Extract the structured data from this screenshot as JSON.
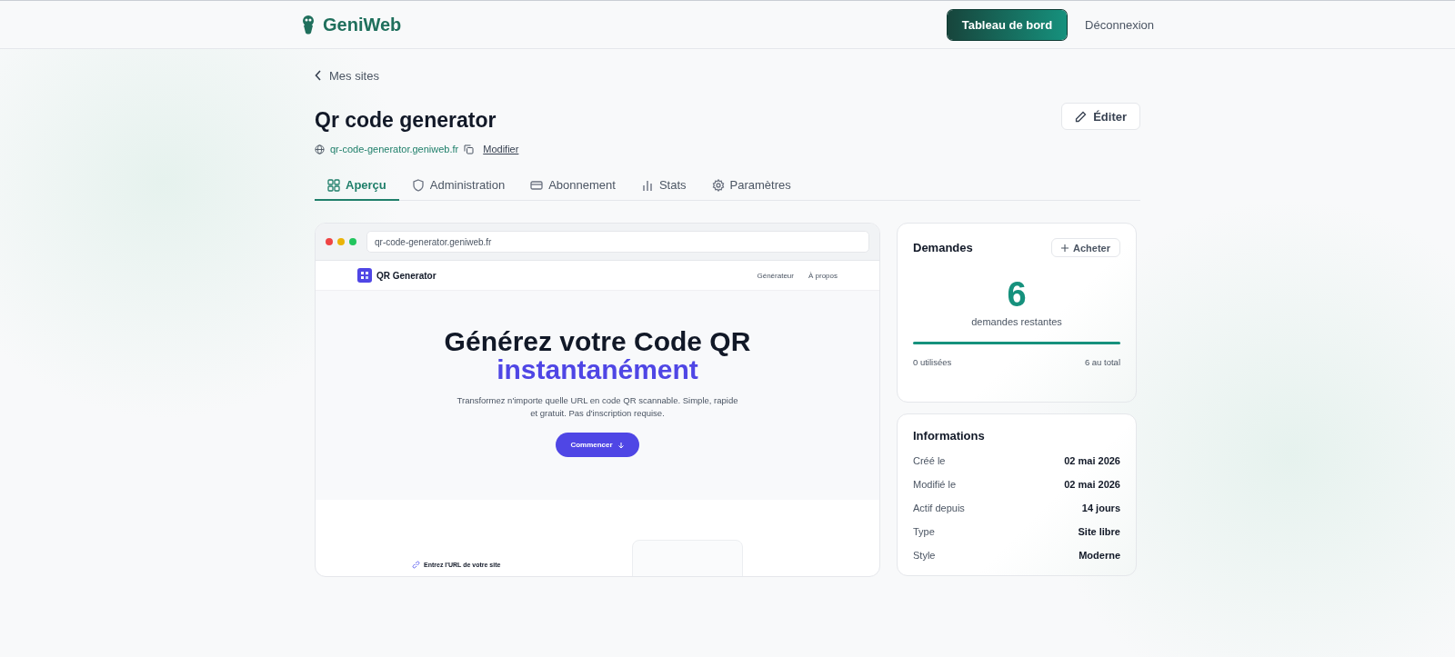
{
  "header": {
    "brand": "GeniWeb",
    "dashboard_button": "Tableau de bord",
    "logout": "Déconnexion"
  },
  "back_link": "Mes sites",
  "site": {
    "title": "Qr code generator",
    "url": "qr-code-generator.geniweb.fr",
    "modify_link": "Modifier",
    "edit_button": "Éditer"
  },
  "tabs": [
    {
      "label": "Aperçu",
      "kind": "grid",
      "selected": true
    },
    {
      "label": "Administration",
      "kind": "shield",
      "selected": false
    },
    {
      "label": "Abonnement",
      "kind": "card",
      "selected": false
    },
    {
      "label": "Stats",
      "kind": "bars",
      "selected": false
    },
    {
      "label": "Paramètres",
      "kind": "gear",
      "selected": false
    }
  ],
  "preview": {
    "address": "qr-code-generator.geniweb.fr",
    "site_brand": "QR Generator",
    "nav": [
      "Générateur",
      "À propos"
    ],
    "headline": "Générez votre Code QR",
    "headline_accent": "instantanément",
    "subtitle": "Transformez n'importe quelle URL en code QR scannable. Simple, rapide et gratuit. Pas d'inscription requise.",
    "cta": "Commencer",
    "step_label": "Entrez l'URL de votre site"
  },
  "requests": {
    "title": "Demandes",
    "buy_button": "Acheter",
    "count": "6",
    "count_label": "demandes restantes",
    "level": 1,
    "used": "0 utilisées",
    "total": "6 au total"
  },
  "info": {
    "title": "Informations",
    "rows": [
      {
        "label": "Créé le",
        "value": "02 mai 2026"
      },
      {
        "label": "Modifié le",
        "value": "02 mai 2026"
      },
      {
        "label": "Actif depuis",
        "value": "14 jours"
      },
      {
        "label": "Type",
        "value": "Site libre"
      },
      {
        "label": "Style",
        "value": "Moderne"
      }
    ]
  }
}
